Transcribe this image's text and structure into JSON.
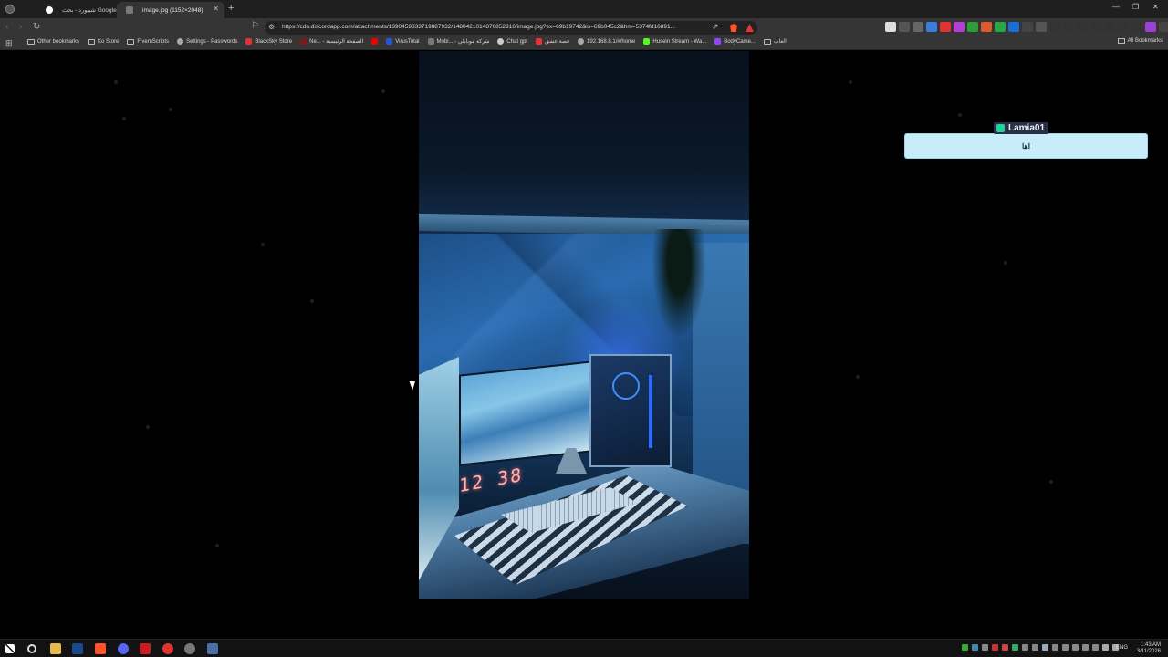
{
  "tabs": [
    {
      "label": "شيبورد - بحث Google",
      "active": false
    },
    {
      "label": "image.jpg (1152×2048)",
      "active": true
    }
  ],
  "address_bar": {
    "url": "https://cdn.discordapp.com/attachments/1390459333719887932/1480421014876852316/image.jpg?ex=69b19742&is=69b045c2&hm=5374fd16891..."
  },
  "bookmarks": [
    {
      "label": "Other bookmarks",
      "icon": "folder-icon"
    },
    {
      "label": "Ko Store",
      "icon": "folder-icon"
    },
    {
      "label": "FivemScripts",
      "icon": "folder-icon"
    },
    {
      "label": "Settings - Passwords",
      "icon": "gear-icon"
    },
    {
      "label": "BlackSky Store",
      "icon": "store-icon"
    },
    {
      "label": "Ne... - الصفحة الرئيسية",
      "icon": "news-icon"
    },
    {
      "label": "",
      "icon": "youtube-icon"
    },
    {
      "label": "VirusTotal",
      "icon": "virustotal-icon"
    },
    {
      "label": "Mobi... - شركة موبايلي",
      "icon": "mobily-icon"
    },
    {
      "label": "Chat gpt",
      "icon": "chatgpt-icon"
    },
    {
      "label": "قصة عشق",
      "icon": "story-icon"
    },
    {
      "label": "192.168.8.1/#/home",
      "icon": "router-icon"
    },
    {
      "label": "Husein Stream - Wa...",
      "icon": "kick-icon"
    },
    {
      "label": "BodyCame...",
      "icon": "twitch-icon"
    },
    {
      "label": "العاب",
      "icon": "folder-icon"
    }
  ],
  "bookmarks_all": "All Bookmarks",
  "photo": {
    "clock_display": "12 38"
  },
  "chat": {
    "username": "Lamia01",
    "message": "اها"
  },
  "taskbar": {
    "language": "ENG",
    "time": "1:43 AM",
    "date": "3/11/2026"
  }
}
